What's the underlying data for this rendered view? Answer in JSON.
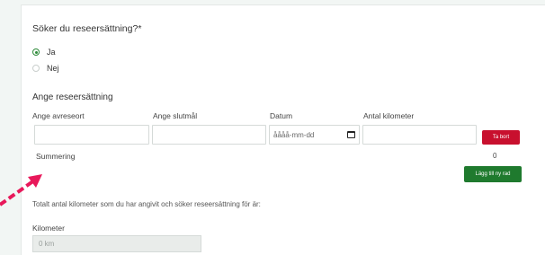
{
  "question": {
    "title": "Söker du reseersättning?*"
  },
  "options": [
    {
      "label": "Ja",
      "checked": true
    },
    {
      "label": "Nej",
      "checked": false
    }
  ],
  "section": {
    "title": "Ange reseersättning",
    "columns": [
      "Ange avreseort",
      "Ange slutmål",
      "Datum",
      "Antal kilometer"
    ],
    "row": {
      "from": "",
      "to": "",
      "date_placeholder": "åååå-mm-dd",
      "km": ""
    },
    "remove_label": "Ta bort"
  },
  "summary": {
    "label": "Summering",
    "value": "0",
    "add_row_label": "Lägg till ny rad"
  },
  "total": {
    "text": "Totalt antal kilometer som du har angivit och söker reseersättning för är:"
  },
  "kilometer": {
    "label": "Kilometer",
    "placeholder": "0 km"
  },
  "colors": {
    "accent_green": "#2e8a3a",
    "button_green": "#1f7a2e",
    "button_red": "#c8102e",
    "arrow": "#e8185a"
  },
  "icons": {
    "date": "calendar-icon",
    "annotation": "arrow-pointer-icon"
  }
}
